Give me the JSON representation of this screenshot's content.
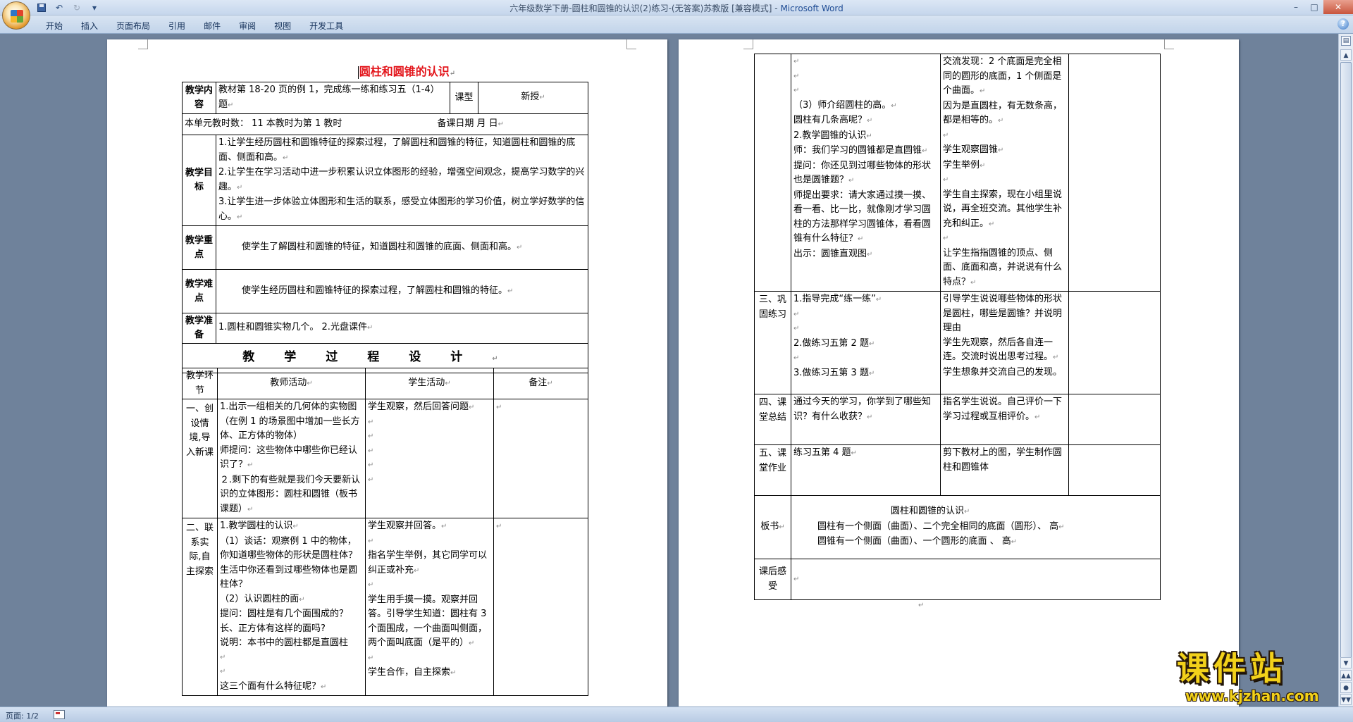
{
  "window": {
    "title_doc": "六年级数学下册-圆柱和圆锥的认识(2)练习-(无答案)苏教版 [兼容模式] - ",
    "title_app": "Microsoft Word"
  },
  "qat": {
    "undo": "↶",
    "redo": "↻",
    "customize": "▾"
  },
  "ribbon": {
    "tabs": [
      "开始",
      "插入",
      "页面布局",
      "引用",
      "邮件",
      "审阅",
      "视图",
      "开发工具"
    ]
  },
  "status": {
    "page": "页面: 1/2"
  },
  "mark": "↵",
  "page1": {
    "title": "圆柱和圆锥的认识",
    "info": {
      "content_label": "教学内容",
      "content": "教材第 18-20 页的例 1，完成练一练和练习五（1-4）题",
      "type_label": "课型",
      "type": "新授",
      "unit_line": "本单元教时数：  11     本教时为第  1  教时",
      "date_line": "备课日期    月    日"
    },
    "goals": {
      "label": "教学目标",
      "items": [
        "1.让学生经历圆柱和圆锥特征的探索过程，了解圆柱和圆锥的特征，知道圆柱和圆锥的底面、侧面和高。",
        "2.让学生在学习活动中进一步积累认识立体图形的经验，增强空间观念，提高学习数学的兴趣。",
        "3.让学生进一步体验立体图形和生活的联系，感受立体图形的学习价值，树立学好数学的信心。"
      ]
    },
    "key": {
      "label": "教学重点",
      "text": "使学生了解圆柱和圆锥的特征，知道圆柱和圆锥的底面、侧面和高。"
    },
    "difficulty": {
      "label": "教学难点",
      "text": "使学生经历圆柱和圆锥特征的探索过程，了解圆柱和圆锥的特征。"
    },
    "prep": {
      "label": "教学准备",
      "text": "1.圆柱和圆锥实物几个。   2.光盘课件"
    },
    "design_heading": "教学过程设计",
    "columns": {
      "step": "教学环节",
      "teacher": "教师活动",
      "student": "学生活动",
      "note": "备注"
    },
    "rows": [
      {
        "step": "一、创设情境,导入新课",
        "teacher": [
          "1.出示一组相关的几何体的实物图（在例 1 的场景图中增加一些长方体、正方体的物体）",
          "师提问：这些物体中哪些你已经认识了？",
          "２.剩下的有些就是我们今天要新认识的立体图形：圆柱和圆锥（板书课题）"
        ],
        "student": [
          "学生观察，然后回答问题"
        ]
      },
      {
        "step": "二、联系实际,自主探索",
        "teacher": [
          "1.教学圆柱的认识",
          "（1）谈话：观察例 1 中的物体，你知道哪些物体的形状是圆柱体？生活中你还看到过哪些物体也是圆柱体？",
          "（2）认识圆柱的面",
          "提问：圆柱是有几个面围成的？长、正方体有这样的面吗?",
          "说明：本书中的圆柱都是直圆柱",
          "",
          "这三个面有什么特征呢？"
        ],
        "student": [
          "学生观察并回答。",
          "",
          "指名学生举例，其它同学可以纠正或补充",
          "",
          "学生用手摸一摸。观察并回答。引导学生知道：圆柱有 3 个面围成，一个曲面叫侧面，两个面叫底面（是平的）",
          "",
          "学生合作，自主探索"
        ]
      }
    ]
  },
  "page2": {
    "cont_row": {
      "teacher": [
        "",
        "",
        "（3）师介绍圆柱的高。",
        "圆柱有几条高呢？",
        "2.教学圆锥的认识",
        "师：我们学习的圆锥都是直圆锥",
        "提问：你还见到过哪些物体的形状也是圆锥题？",
        "师提出要求：请大家通过摸一摸、看一看、比一比，就像刚才学习圆柱的方法那样学习圆锥体，看看圆锥有什么特征？",
        "出示：圆锥直观图"
      ],
      "student": [
        "交流发现：2 个底面是完全相同的圆形的底面，1 个侧面是个曲面。",
        "因为是直圆柱，有无数条高，都是相等的。",
        "",
        "学生观察圆锥",
        "学生举例",
        "",
        "学生自主探索，现在小组里说说，再全班交流。其他学生补充和纠正。",
        "",
        "让学生指指圆锥的顶点、侧面、底面和高，并说说有什么特点？"
      ]
    },
    "rows": [
      {
        "step": "三、巩固练习",
        "teacher": [
          "1.指导完成“练一练”",
          "",
          "2.做练习五第 2 题",
          "",
          "3.做练习五第 3 题"
        ],
        "student": [
          "引导学生说说哪些物体的形状是圆柱，哪些是圆锥？并说明理由",
          "学生先观察，然后各自连一连。交流时说出思考过程。",
          "学生想象并交流自己的发现。"
        ]
      },
      {
        "step": "四、课堂总结",
        "teacher": [
          "通过今天的学习，你学到了哪些知识？有什么收获？"
        ],
        "student": [
          "指名学生说说。自己评价一下学习过程或互相评价。"
        ]
      },
      {
        "step": "五、课堂作业",
        "teacher": [
          "练习五第 4 题"
        ],
        "student": [
          "剪下教材上的图，学生制作圆柱和圆锥体"
        ]
      }
    ],
    "board": {
      "label": "板书",
      "title": "圆柱和圆锥的认识",
      "line1": "圆柱有一个侧面（曲面）、二个完全相同的底面（圆形）、 高",
      "line2": "圆锥有一个侧面（曲面）、一个圆形的底面  、 高"
    },
    "reflection": {
      "label": "课后感受"
    }
  },
  "watermark": {
    "main": "课件站",
    "url": "www.kjzhan.com"
  },
  "colors": {
    "title_red": "#e3151b",
    "watermark_yellow": "#f2d11a",
    "app_blue": "#1f4c94"
  }
}
